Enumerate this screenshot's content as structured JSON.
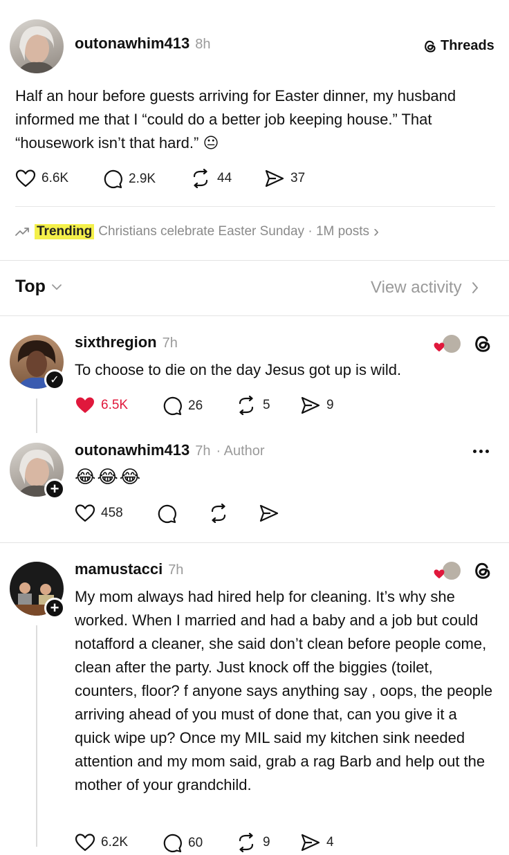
{
  "post": {
    "username": "outonawhim413",
    "time": "8h",
    "brand": "Threads",
    "text": "Half an hour before guests arriving for Easter dinner, my husband informed me that I “could do a better job keeping house.” That “housework isn’t that hard.”",
    "emoji": "😐",
    "likes": "6.6K",
    "replies": "2.9K",
    "reposts": "44",
    "shares": "37"
  },
  "trending": {
    "label": "Trending",
    "topic": "Christians celebrate Easter Sunday · 1M posts",
    "chevron": "›"
  },
  "sort": {
    "label": "Top",
    "view_activity": "View activity"
  },
  "replies": [
    {
      "username": "sixthregion",
      "time": "7h",
      "text": "To choose to die on the day Jesus got up is wild.",
      "likes": "6.5K",
      "replies": "26",
      "reposts": "5",
      "shares": "9",
      "liked": true
    },
    {
      "username": "outonawhim413",
      "time": "7h",
      "author_tag": "· Author",
      "emojis": "😂😂😂",
      "likes": "458"
    },
    {
      "username": "mamustacci",
      "time": "7h",
      "text": "My mom always had hired help for cleaning. It’s why she worked. When I married and had a baby and a job but could notafford a cleaner, she said don’t clean before people come, clean after the party. Just knock off the biggies (toilet, counters, floor? f anyone says anything say , oops, the people arriving ahead of you must of done that, can you give it a quick wipe up? Once my MIL said my kitchen sink needed attention and my mom said, grab a rag Barb and help out the mother of your grandchild.",
      "likes": "6.2K",
      "replies": "60",
      "reposts": "9",
      "shares": "4"
    }
  ],
  "colors": {
    "like_red": "#e0183c",
    "trending_highlight": "#f4f04a",
    "muted": "#9a9a9a"
  }
}
